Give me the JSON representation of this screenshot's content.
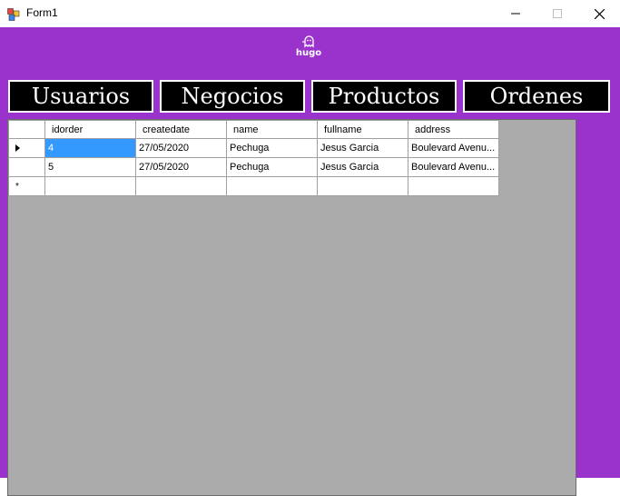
{
  "window": {
    "title": "Form1",
    "controls": {
      "minimize": "minimize-icon",
      "maximize": "maximize-icon",
      "close": "close-icon"
    }
  },
  "logo": {
    "text": "hugo",
    "icon": "ghost-logo-icon"
  },
  "nav": {
    "buttons": [
      {
        "label": "Usuarios"
      },
      {
        "label": "Negocios"
      },
      {
        "label": "Productos"
      },
      {
        "label": "Ordenes"
      }
    ]
  },
  "grid": {
    "columns": [
      "idorder",
      "createdate",
      "name",
      "fullname",
      "address"
    ],
    "rows": [
      {
        "idorder": "4",
        "createdate": "27/05/2020",
        "name": "Pechuga",
        "fullname": "Jesus Garcia",
        "address": "Boulevard Avenu..."
      },
      {
        "idorder": "5",
        "createdate": "27/05/2020",
        "name": "Pechuga",
        "fullname": "Jesus Garcia",
        "address": "Boulevard Avenu..."
      }
    ],
    "new_row_marker": "*"
  },
  "colors": {
    "background": "#9a33cc",
    "button": "#000000",
    "button_text": "#ffffff",
    "selection": "#3399ff",
    "grid_bg": "#ababab"
  }
}
